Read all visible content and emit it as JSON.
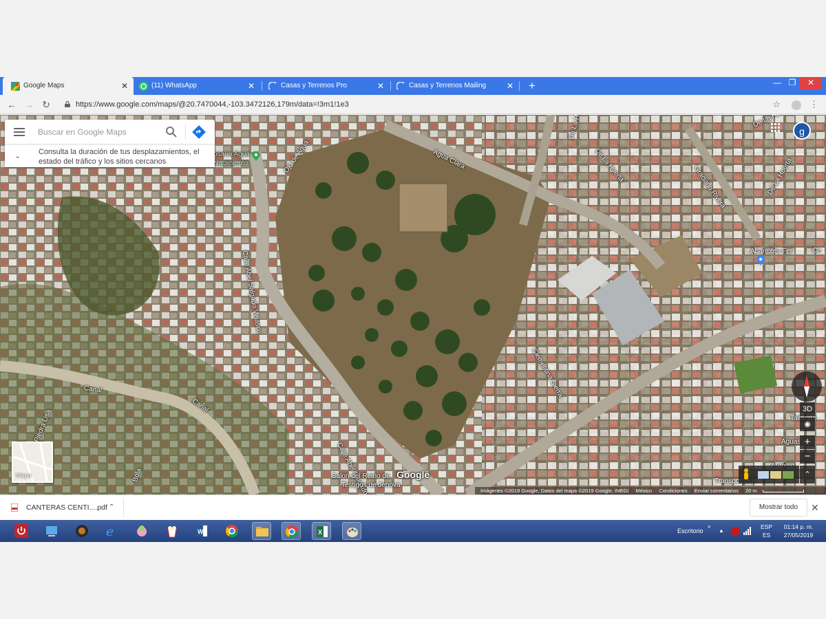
{
  "browser": {
    "tabs": [
      {
        "title": "Google Maps",
        "active": true,
        "icon": "google-maps-icon"
      },
      {
        "title": "(11) WhatsApp",
        "active": false,
        "icon": "whatsapp-icon"
      },
      {
        "title": "Casas y Terrenos Pro",
        "active": false,
        "icon": "loading-icon"
      },
      {
        "title": "Casas y Terrenos Mailing",
        "active": false,
        "icon": "loading-icon"
      }
    ],
    "url": "https://www.google.com/maps/@20.7470044,-103.3472126,179m/data=!3m1!1e3"
  },
  "maps": {
    "search_placeholder": "Buscar en Google Maps",
    "info_text": "Consulta la duración de tus desplazamientos, el estado del tráfico y los sitios cercanos",
    "avatar_letter": "g",
    "minimap_label": "Mapa",
    "logo": "Google",
    "view_3d": "3D",
    "zoom_in": "+",
    "zoom_out": "−",
    "attribution": {
      "imagery": "Imágenes ©2019 Google, Datos del mapa ©2019 Google, INEGI",
      "region": "México",
      "terms": "Condiciones",
      "feedback": "Enviar comentarios",
      "scale": "20 m"
    },
    "street_labels": {
      "agua_clara": "Agua Clara",
      "ojo_de_agua": "Ojo de Agua",
      "calle_abel_1": "Calle Abel Salgado Velasco",
      "calle_abel_2": "Calle Abel Salgado Velasco",
      "de_la_huerta_1": "De La Huerta",
      "de_la_huerta_2": "De La Huerta",
      "de_la_huerta_3": "De La Huerta",
      "de_la_huerta_4": "De La Huerta",
      "graciano_rivera": "Graciano Rivera",
      "clementina_sierra": "Clementina Sierra",
      "canal_1": "Canal",
      "canal_2": "Canal",
      "piedra_lisa": "Piedra Lisa",
      "bola": "Bola",
      "abarrotes": "Abarrotes Fer",
      "ce": "Ce",
      "rosario_agua": "osario Agua",
      "nacimiento": "Nacimiento",
      "taller": "Taller de",
      "aguas": "Aguas",
      "automo": "Automo",
      "transp": "Transporte de",
      "salon_1": "Salon del Reino de",
      "salon_2": "Testigos de Jehova"
    }
  },
  "downloads": {
    "file_name": "CANTERAS CENTI....pdf",
    "show_all": "Mostrar todo"
  },
  "taskbar": {
    "desktop_label": "Escritorio",
    "lang_top": "ESP",
    "lang_bottom": "ES",
    "time": "01:14 p. m.",
    "date": "27/05/2019"
  },
  "colors": {
    "tab_strip": "#3b78e7",
    "taskbar": "#2a4c8c",
    "avatar": "#1e57a7",
    "poi_green": "#34a853",
    "poi_blue": "#4285f4"
  }
}
